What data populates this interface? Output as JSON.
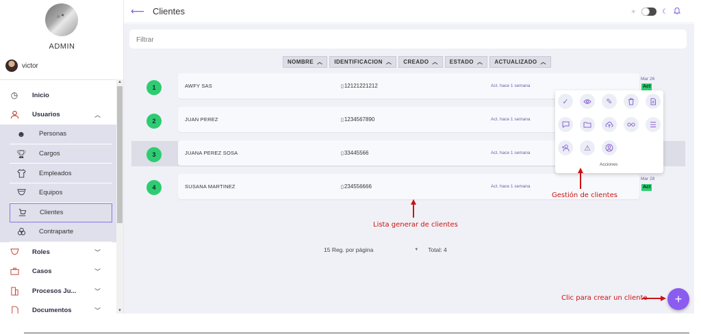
{
  "sidebar": {
    "admin_label": "ADMIN",
    "user_name": "victor",
    "items": [
      {
        "label": "Inicio",
        "icon": "clock-icon"
      },
      {
        "label": "Usuarios",
        "icon": "user-icon"
      },
      {
        "label": "Roles",
        "icon": "badge-icon"
      },
      {
        "label": "Casos",
        "icon": "briefcase-icon"
      },
      {
        "label": "Procesos Ju...",
        "icon": "building-icon"
      },
      {
        "label": "Documentos",
        "icon": "document-icon"
      }
    ],
    "sub_items": [
      {
        "label": "Personas",
        "icon": "people-icon"
      },
      {
        "label": "Cargos",
        "icon": "trophy-icon"
      },
      {
        "label": "Empleados",
        "icon": "shirt-icon"
      },
      {
        "label": "Equipos",
        "icon": "team-icon"
      },
      {
        "label": "Clientes",
        "icon": "cart-icon"
      },
      {
        "label": "Contraparte",
        "icon": "circles-icon"
      }
    ]
  },
  "header": {
    "title": "Clientes"
  },
  "filter": {
    "placeholder": "Filtrar"
  },
  "sort_buttons": [
    "NOMBRE",
    "IDENTIFICACION",
    "CREADO",
    "ESTADO",
    "ACTUALIZADO"
  ],
  "rows": [
    {
      "num": "1",
      "name": "AWFY SAS",
      "id": "12121221212",
      "updated": "Act. hace 1 semana",
      "date": "Mar 26",
      "badge": "Act"
    },
    {
      "num": "2",
      "name": "JUAN PEREZ",
      "id": "1234567890",
      "updated": "Act. hace 1 semana",
      "date": "",
      "badge": ""
    },
    {
      "num": "3",
      "name": "JUANA PEREZ SOSA",
      "id": "33445566",
      "updated": "Act. hace 1 semana",
      "date": "",
      "badge": ""
    },
    {
      "num": "4",
      "name": "SUSANA MARTINEZ",
      "id": "234556666",
      "updated": "Act. hace 1 semana",
      "date": "Mar 28",
      "badge": "Act"
    }
  ],
  "actions": {
    "label": "Acciones",
    "icons": [
      "check-icon",
      "eye-icon",
      "edit-icon",
      "trash-icon",
      "file-icon",
      "comment-icon",
      "folder-icon",
      "cloud-upload-icon",
      "glasses-icon",
      "list-icon",
      "add-user-icon",
      "warning-icon",
      "account-icon"
    ]
  },
  "pager": {
    "per_page": "15 Reg. por página",
    "total": "Total: 4"
  },
  "annotations": {
    "actions_note": "Gestión de clientes",
    "list_note": "Lista generar de clientes",
    "create_note": "Clic para crear un cliente"
  },
  "colors": {
    "accent": "#7b5ce6",
    "fab": "#8a5cf0",
    "status_green": "#2ecc71",
    "annotation_red": "#cc1111",
    "main_bg": "#f0f1f7"
  }
}
